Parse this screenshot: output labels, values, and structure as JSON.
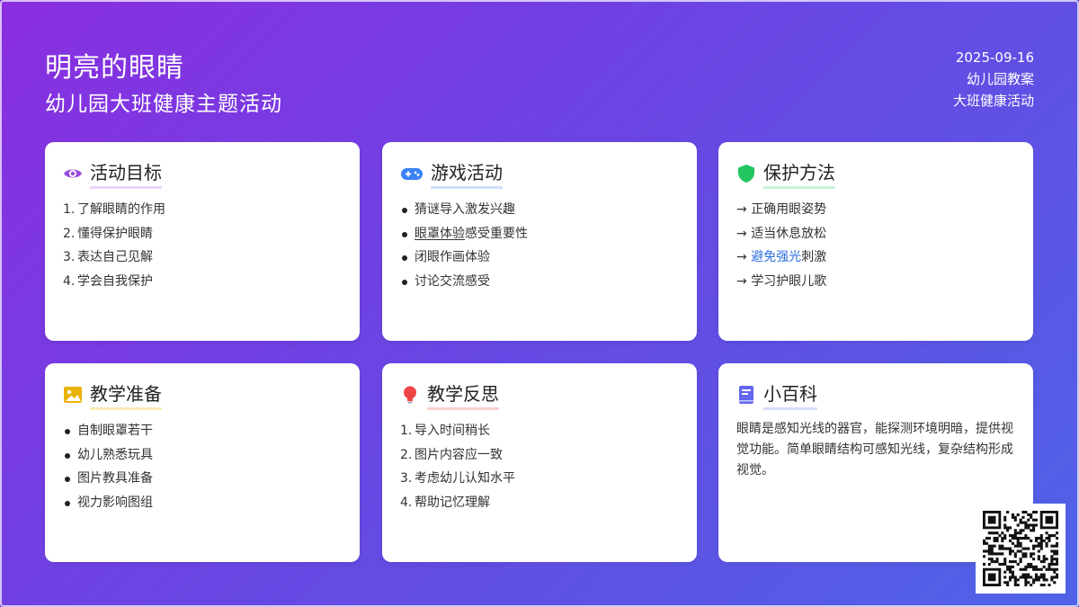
{
  "header": {
    "title": "明亮的眼睛",
    "subtitle": "幼儿园大班健康主题活动",
    "date": "2025-09-16",
    "meta_line2": "幼儿园教案",
    "meta_line3": "大班健康活动"
  },
  "cards": {
    "goals": {
      "icon": "eye-icon",
      "title": "活动目标",
      "items": [
        {
          "num": "1.",
          "text": "了解眼睛的作用"
        },
        {
          "num": "2.",
          "text": "懂得保护眼睛"
        },
        {
          "num": "3.",
          "text": "表达自己见解"
        },
        {
          "num": "4.",
          "text": "学会自我保护"
        }
      ]
    },
    "games": {
      "icon": "gamepad-icon",
      "title": "游戏活动",
      "items": [
        {
          "text": "猜谜导入激发兴趣"
        },
        {
          "text_a": "眼罩体验",
          "text_b": "感受重要性"
        },
        {
          "text": "闭眼作画体验"
        },
        {
          "text": "讨论交流感受"
        }
      ]
    },
    "protect": {
      "icon": "shield-icon",
      "title": "保护方法",
      "items": [
        {
          "arrow": "→",
          "text": "正确用眼姿势"
        },
        {
          "arrow": "→",
          "text": "适当休息放松"
        },
        {
          "arrow": "→",
          "text_a": "避免强光",
          "text_b": "刺激"
        },
        {
          "arrow": "→",
          "text": "学习护眼儿歌"
        }
      ]
    },
    "prep": {
      "icon": "image-icon",
      "title": "教学准备",
      "items": [
        {
          "text": "自制眼罩若干"
        },
        {
          "text": "幼儿熟悉玩具"
        },
        {
          "text": "图片教具准备"
        },
        {
          "text": "视力影响图组"
        }
      ]
    },
    "reflection": {
      "icon": "lightbulb-icon",
      "title": "教学反思",
      "items": [
        {
          "num": "1.",
          "text": "导入时间稍长"
        },
        {
          "num": "2.",
          "text": "图片内容应一致"
        },
        {
          "num": "3.",
          "text": "考虑幼儿认知水平"
        },
        {
          "num": "4.",
          "text": "帮助记忆理解"
        }
      ]
    },
    "wiki": {
      "icon": "book-icon",
      "title": "小百科",
      "text": "眼睛是感知光线的器官，能探测环境明暗，提供视觉功能。简单眼睛结构可感知光线，复杂结构形成视觉。"
    }
  },
  "colors": {
    "bg_start": "#8a2ee0",
    "bg_end": "#4f63e6",
    "eye": "#9b4de0",
    "gamepad": "#3b82f6",
    "shield": "#22c55e",
    "image": "#eab308",
    "bulb": "#ef4444",
    "book": "#6366f1",
    "link": "#2f6fe0"
  },
  "qr_code": {
    "icon": "qr-code-icon"
  }
}
